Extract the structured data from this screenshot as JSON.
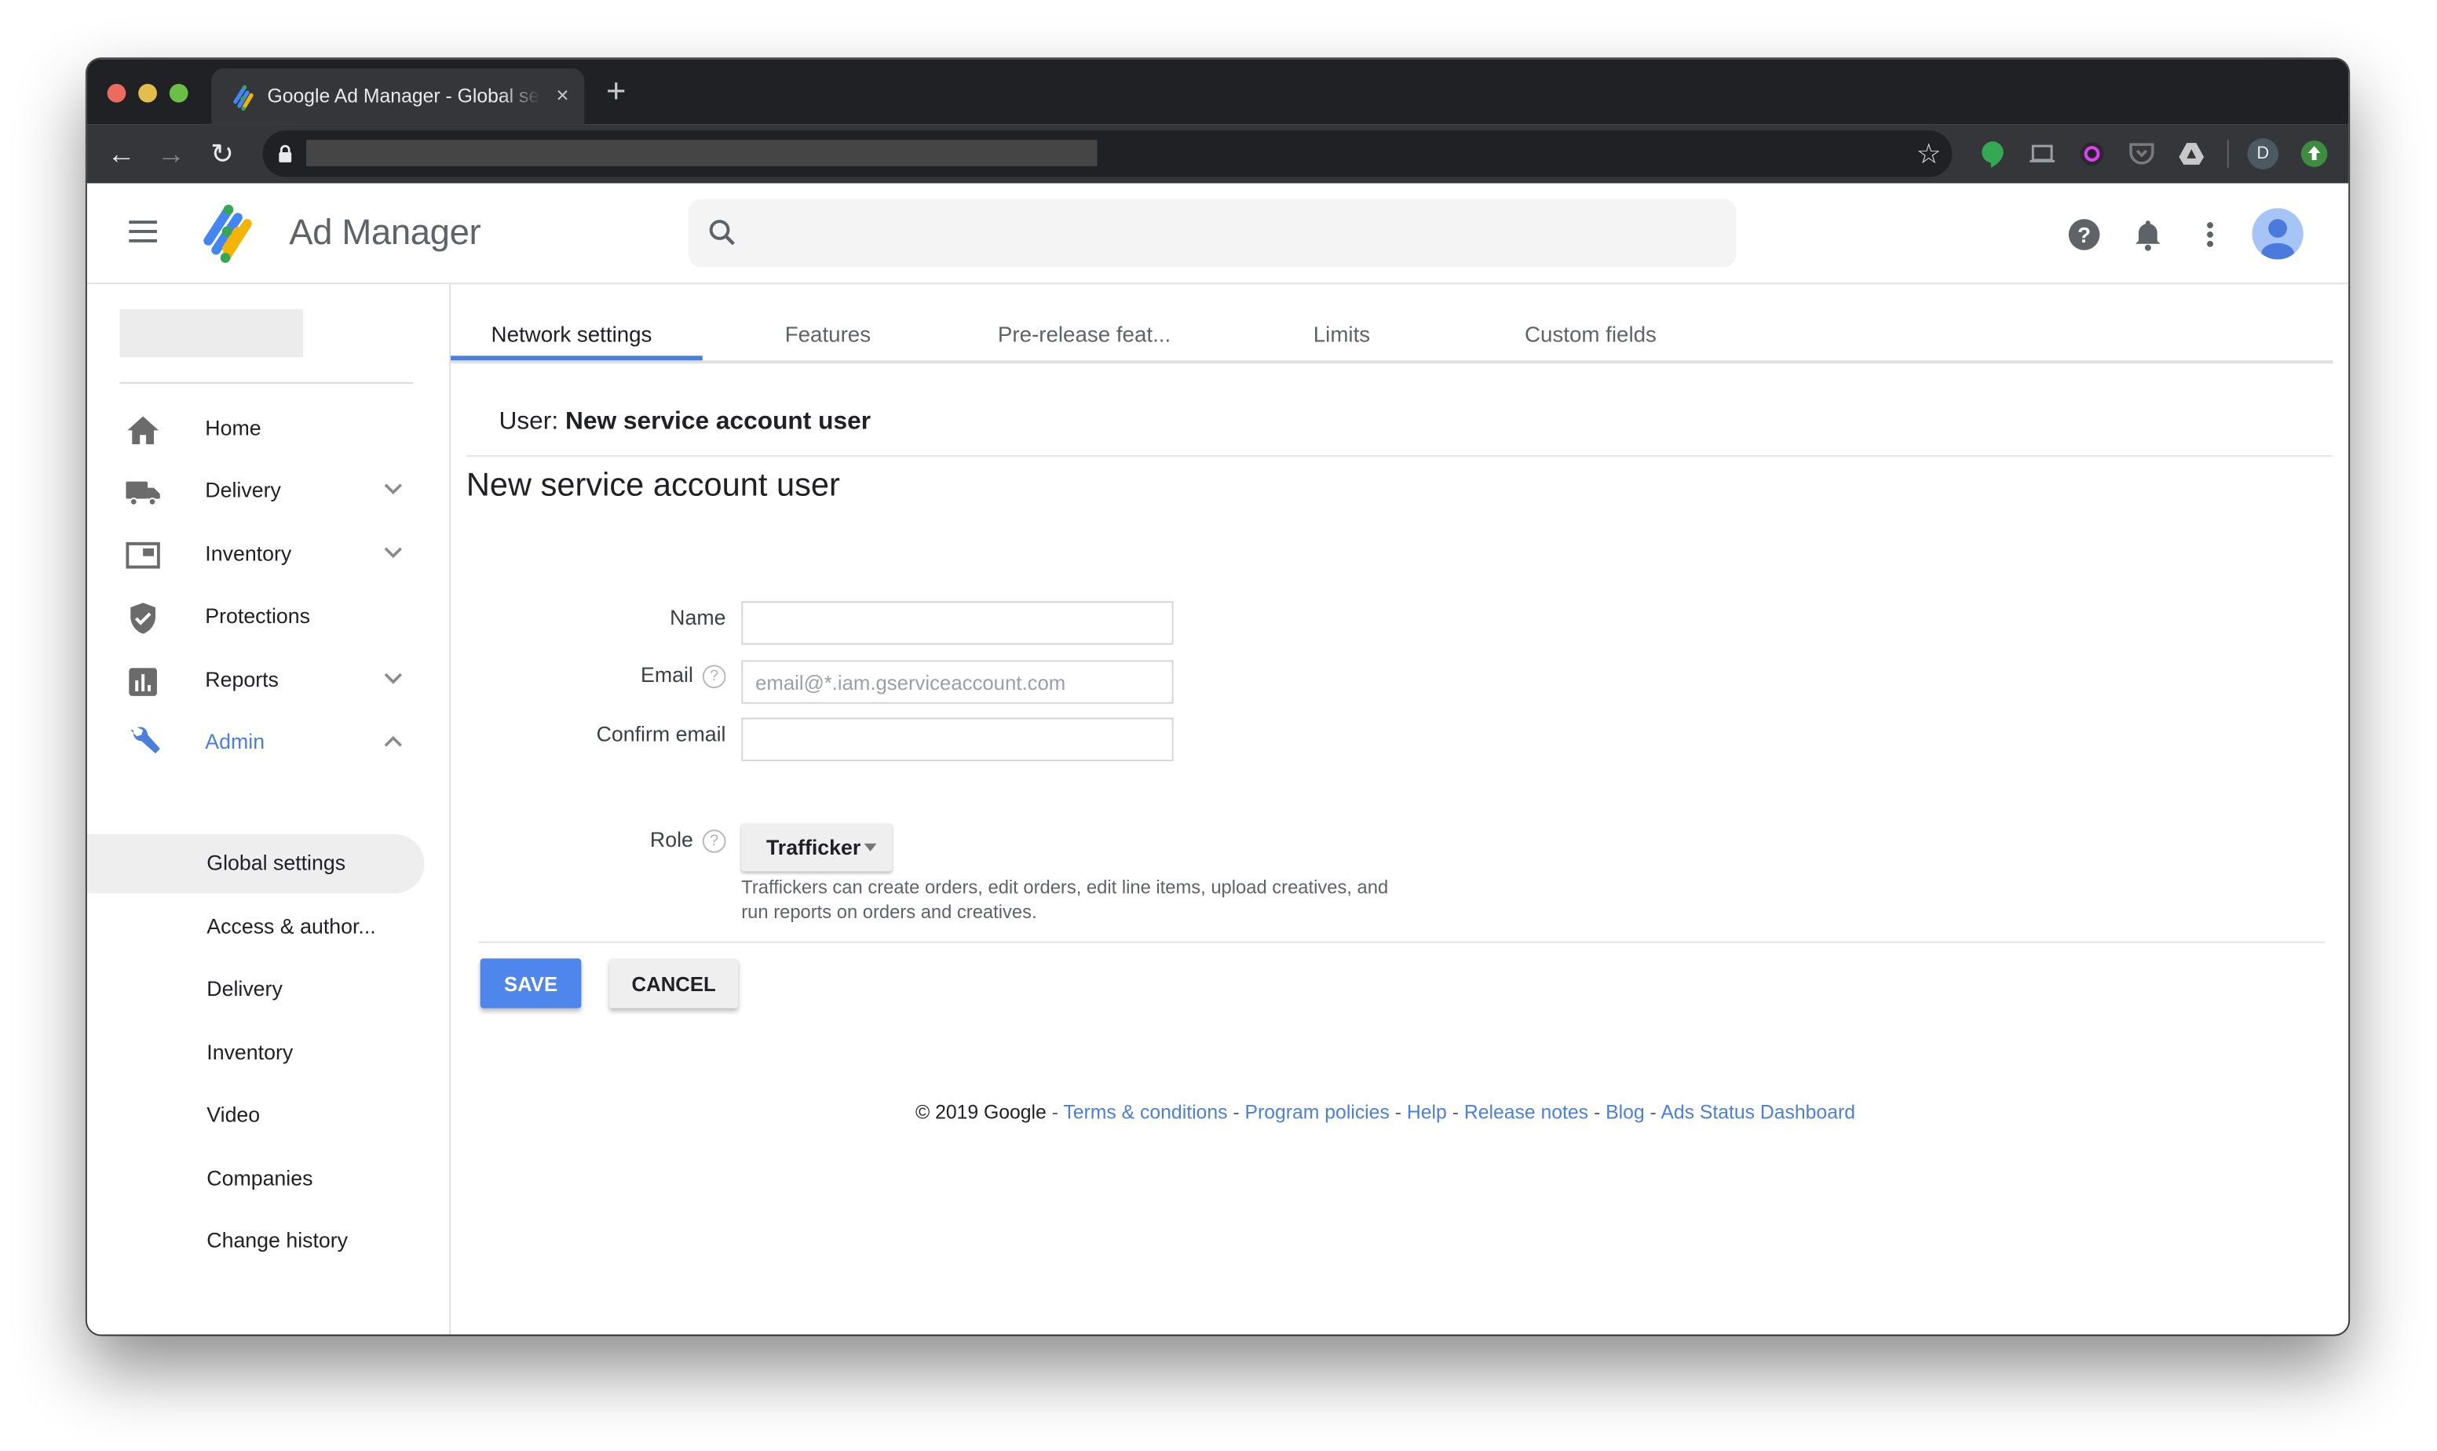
{
  "browser": {
    "tab_title": "Google Ad Manager - Global settings",
    "tab_close": "×",
    "new_tab": "+",
    "nav": {
      "back": "←",
      "forward": "→",
      "reload": "↻"
    },
    "star": "☆",
    "extensions": [
      "hangouts-icon",
      "cast-icon",
      "color-picker-icon",
      "pocket-icon",
      "google-drive-icon"
    ],
    "profile_initial": "D"
  },
  "app": {
    "brand": "Ad Manager",
    "search": {
      "placeholder": ""
    },
    "colors": {
      "accent": "#4a7fe0",
      "save": "#4f86ec",
      "brand_blue": "#4285f4",
      "brand_yellow": "#f4b400",
      "brand_green": "#34a853"
    }
  },
  "sidebar": {
    "items": [
      {
        "label": "Home",
        "icon": "home-icon",
        "expandable": false
      },
      {
        "label": "Delivery",
        "icon": "truck-icon",
        "expandable": true
      },
      {
        "label": "Inventory",
        "icon": "inventory-icon",
        "expandable": true
      },
      {
        "label": "Protections",
        "icon": "shield-icon",
        "expandable": false
      },
      {
        "label": "Reports",
        "icon": "bar-chart-icon",
        "expandable": true
      },
      {
        "label": "Admin",
        "icon": "wrench-icon",
        "expandable": true,
        "expanded": true,
        "active": true
      }
    ],
    "admin_subitems": [
      {
        "label": "Global settings",
        "selected": true
      },
      {
        "label": "Access & author..."
      },
      {
        "label": "Delivery"
      },
      {
        "label": "Inventory"
      },
      {
        "label": "Video"
      },
      {
        "label": "Companies"
      },
      {
        "label": "Change history"
      }
    ]
  },
  "main": {
    "tabs": [
      {
        "label": "Network settings",
        "active": true
      },
      {
        "label": "Features"
      },
      {
        "label": "Pre-release feat..."
      },
      {
        "label": "Limits"
      },
      {
        "label": "Custom fields"
      }
    ],
    "breadcrumb": {
      "prefix": "User:",
      "name": "New service account user"
    },
    "heading": "New service account user",
    "form": {
      "name": {
        "label": "Name",
        "value": "",
        "placeholder": ""
      },
      "email": {
        "label": "Email",
        "value": "",
        "placeholder": "email@*.iam.gserviceaccount.com"
      },
      "confirm_email": {
        "label": "Confirm email",
        "value": "",
        "placeholder": ""
      },
      "role": {
        "label": "Role",
        "value": "Trafficker",
        "description": "Traffickers can create orders, edit orders, edit line items, upload creatives, and run reports on orders and creatives."
      },
      "help_glyph": "?"
    },
    "save_label": "SAVE",
    "cancel_label": "CANCEL"
  },
  "footer": {
    "copyright": "© 2019 Google",
    "separator": "-",
    "links": [
      "Terms & conditions",
      "Program policies",
      "Help",
      "Release notes",
      "Blog",
      "Ads Status Dashboard"
    ]
  }
}
